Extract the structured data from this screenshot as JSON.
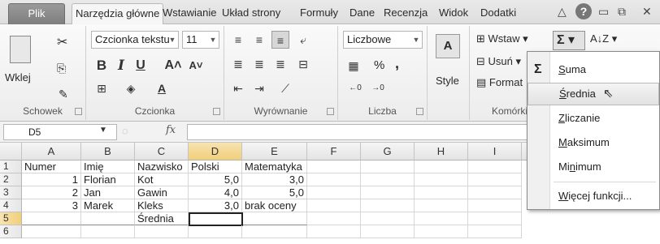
{
  "tabs": [
    "Plik",
    "Narzędzia główne",
    "Wstawianie",
    "Układ strony",
    "Formuły",
    "Dane",
    "Recenzja",
    "Widok",
    "Dodatki"
  ],
  "ribbon": {
    "clipboard": {
      "paste": "Wklej",
      "label": "Schowek"
    },
    "font": {
      "name": "Czcionka tekstu",
      "size": "11",
      "label": "Czcionka"
    },
    "alignment": {
      "label": "Wyrównanie"
    },
    "number": {
      "format": "Liczbowe",
      "percent": "%",
      "comma": ",",
      "label": "Liczba"
    },
    "styles": {
      "label": "Style"
    },
    "cells": {
      "insert": "Wstaw",
      "delete": "Usuń",
      "format": "Format",
      "label": "Komórki"
    }
  },
  "formula_bar": {
    "name_box": "D5",
    "fx": "fx",
    "value": ""
  },
  "grid": {
    "columns": [
      "A",
      "B",
      "C",
      "D",
      "E",
      "F",
      "G",
      "H",
      "I"
    ],
    "rows": [
      {
        "num": "1",
        "cells": [
          "Numer",
          "Imię",
          "Nazwisko",
          "Polski",
          "Matematyka",
          "",
          "",
          "",
          ""
        ]
      },
      {
        "num": "2",
        "cells": [
          "1",
          "Florian",
          "Kot",
          "5,0",
          "3,0",
          "",
          "",
          "",
          ""
        ]
      },
      {
        "num": "3",
        "cells": [
          "2",
          "Jan",
          "Gawin",
          "4,0",
          "5,0",
          "",
          "",
          "",
          ""
        ]
      },
      {
        "num": "4",
        "cells": [
          "3",
          "Marek",
          "Kleks",
          "3,0",
          "brak oceny",
          "",
          "",
          "",
          ""
        ]
      },
      {
        "num": "5",
        "cells": [
          "",
          "",
          "Średnia",
          "",
          "",
          "",
          "",
          "",
          ""
        ]
      },
      {
        "num": "6",
        "cells": [
          "",
          "",
          "",
          "",
          "",
          "",
          "",
          "",
          ""
        ]
      }
    ]
  },
  "autosum_menu": {
    "items": [
      {
        "pre": "",
        "u": "S",
        "post": "uma"
      },
      {
        "pre": "",
        "u": "Ś",
        "post": "rednia"
      },
      {
        "pre": "",
        "u": "Z",
        "post": "liczanie"
      },
      {
        "pre": "",
        "u": "M",
        "post": "aksimum"
      },
      {
        "pre": "Mi",
        "u": "n",
        "post": "imum"
      },
      {
        "pre": "",
        "u": "W",
        "post": "ięcej funkcji..."
      }
    ],
    "sigma": "Σ"
  }
}
